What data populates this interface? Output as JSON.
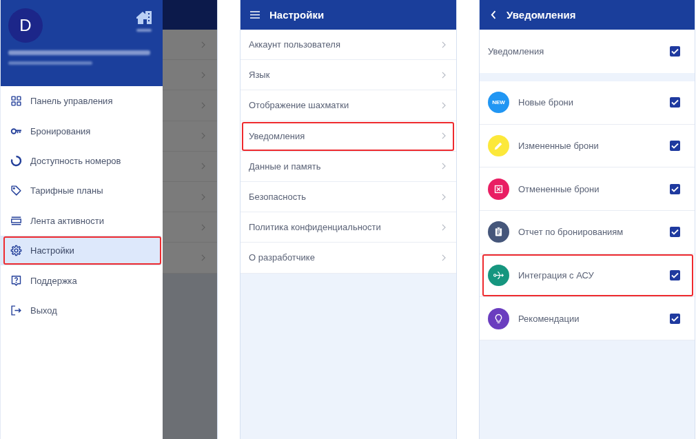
{
  "drawer": {
    "avatar_letter": "D",
    "menu": [
      {
        "label": "Панель управления",
        "kind": "grid",
        "selected": false,
        "highlighted": false
      },
      {
        "label": "Бронирования",
        "kind": "key",
        "selected": false,
        "highlighted": false
      },
      {
        "label": "Доступность номеров",
        "kind": "ring",
        "selected": false,
        "highlighted": false
      },
      {
        "label": "Тарифные планы",
        "kind": "tag",
        "selected": false,
        "highlighted": false
      },
      {
        "label": "Лента активности",
        "kind": "feed",
        "selected": false,
        "highlighted": false
      },
      {
        "label": "Настройки",
        "kind": "gear",
        "selected": true,
        "highlighted": true
      },
      {
        "label": "Поддержка",
        "kind": "help",
        "selected": false,
        "highlighted": false
      },
      {
        "label": "Выход",
        "kind": "exit",
        "selected": false,
        "highlighted": false
      }
    ],
    "backdrop_rows": [
      {
        "chevron": true
      },
      {
        "chevron": true
      },
      {
        "chevron": true
      },
      {
        "chevron": true
      },
      {
        "chevron": true
      },
      {
        "chevron": true
      },
      {
        "chevron": true
      },
      {
        "chevron": true
      }
    ]
  },
  "settings": {
    "title": "Настройки",
    "items": [
      {
        "label": "Аккаунт пользователя",
        "highlighted": false
      },
      {
        "label": "Язык",
        "highlighted": false
      },
      {
        "label": "Отображение шахматки",
        "highlighted": false
      },
      {
        "label": "Уведомления",
        "highlighted": true
      },
      {
        "label": "Данные и память",
        "highlighted": false
      },
      {
        "label": "Безопасность",
        "highlighted": false
      },
      {
        "label": "Политика конфиденциальности",
        "highlighted": false
      },
      {
        "label": "О разработчике",
        "highlighted": false
      }
    ]
  },
  "notifications": {
    "title": "Уведомления",
    "master": {
      "label": "Уведомления",
      "checked": true
    },
    "items": [
      {
        "label": "Новые брони",
        "kind": "new",
        "badge": "NEW",
        "color": "#2196f3",
        "checked": true,
        "highlighted": false
      },
      {
        "label": "Измененные брони",
        "kind": "edit",
        "color": "#fce83a",
        "checked": true,
        "highlighted": false
      },
      {
        "label": "Отмененные брони",
        "kind": "cancel",
        "color": "#e91e63",
        "checked": true,
        "highlighted": false
      },
      {
        "label": "Отчет по бронированиям",
        "kind": "report",
        "color": "#45567a",
        "checked": true,
        "highlighted": false
      },
      {
        "label": "Интеграция с АСУ",
        "kind": "integration",
        "color": "#16967f",
        "checked": true,
        "highlighted": true
      },
      {
        "label": "Рекомендации",
        "kind": "tip",
        "color": "#6a3dbf",
        "checked": true,
        "highlighted": false
      }
    ]
  }
}
